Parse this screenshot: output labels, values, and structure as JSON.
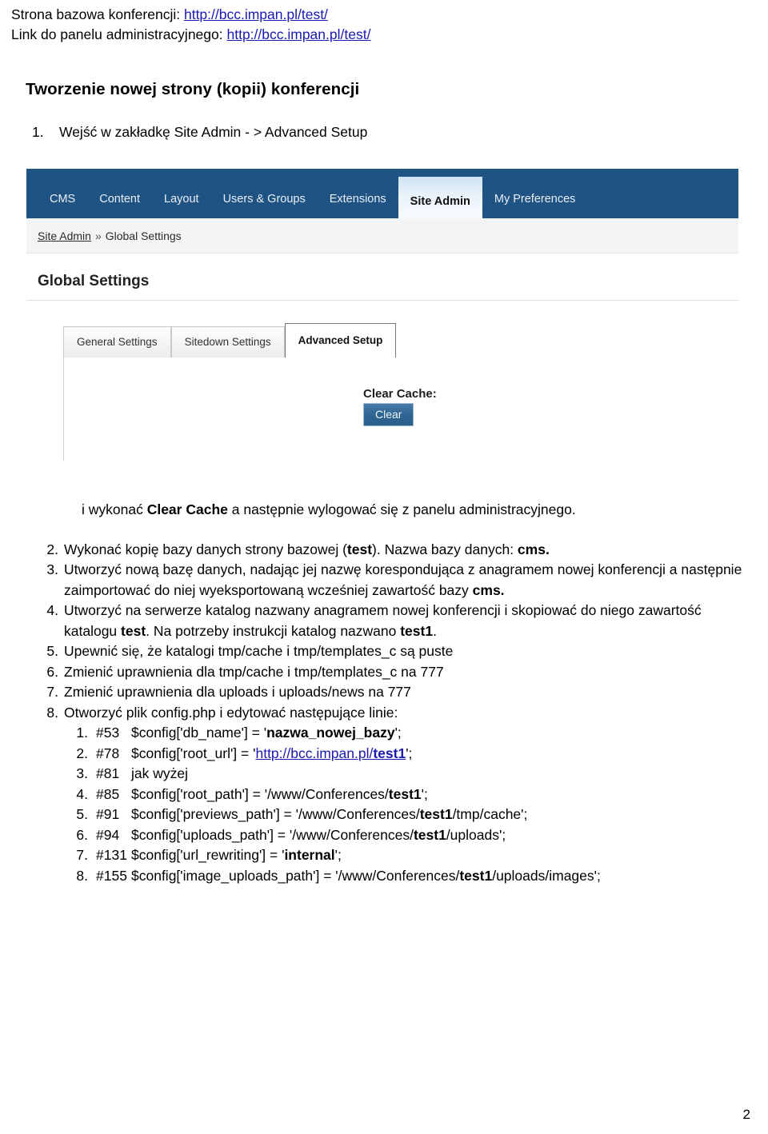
{
  "header": {
    "line1_label": "Strona bazowa konferencji: ",
    "line1_url": "http://bcc.impan.pl/test/",
    "line2_label": "Link do panelu administracyjnego: ",
    "line2_url": "http://bcc.impan.pl/test/"
  },
  "title": "Tworzenie nowej strony (kopii) konferencji",
  "step_one": {
    "number": "1.",
    "text": "Wejść w zakładkę Site Admin - > Advanced Setup"
  },
  "cms_screenshot": {
    "nav_tabs": [
      {
        "label": "CMS",
        "active": false
      },
      {
        "label": "Content",
        "active": false
      },
      {
        "label": "Layout",
        "active": false
      },
      {
        "label": "Users & Groups",
        "active": false
      },
      {
        "label": "Extensions",
        "active": false
      },
      {
        "label": "Site Admin",
        "active": true
      },
      {
        "label": "My Preferences",
        "active": false
      }
    ],
    "breadcrumb": {
      "root": "Site Admin",
      "separator": "»",
      "current": "Global Settings"
    },
    "page_heading": "Global Settings",
    "sub_tabs": [
      {
        "label": "General Settings",
        "active": false
      },
      {
        "label": "Sitedown Settings",
        "active": false
      },
      {
        "label": "Advanced Setup",
        "active": true
      }
    ],
    "clear_cache_label": "Clear Cache:",
    "clear_button_label": "Clear",
    "colors": {
      "navbar_blue": "#1f5384",
      "active_tab_gradient_top": "#cfe2f3",
      "clear_button_blue": "#2e6492"
    }
  },
  "after_screenshot_paragraph": {
    "part1": "i wykonać ",
    "bold": "Clear Cache",
    "part2": " a następnie wylogować się z panelu administracyjnego."
  },
  "steps": [
    {
      "n": 2,
      "segments": [
        {
          "t": "Wykonać kopię bazy danych strony bazowej (",
          "b": false
        },
        {
          "t": "test",
          "b": true
        },
        {
          "t": "). Nazwa bazy danych: ",
          "b": false
        },
        {
          "t": "cms.",
          "b": true
        }
      ]
    },
    {
      "n": 3,
      "segments": [
        {
          "t": "Utworzyć nową bazę danych, nadając jej nazwę korespondująca z anagramem nowej konferencji a następnie zaimportować do niej wyeksportowaną wcześniej zawartość bazy ",
          "b": false
        },
        {
          "t": "cms.",
          "b": true
        }
      ]
    },
    {
      "n": 4,
      "segments": [
        {
          "t": "Utworzyć na serwerze katalog nazwany anagramem nowej konferencji i skopiować do niego zawartość katalogu ",
          "b": false
        },
        {
          "t": "test",
          "b": true
        },
        {
          "t": ". Na potrzeby instrukcji katalog nazwano ",
          "b": false
        },
        {
          "t": "test1",
          "b": true
        },
        {
          "t": ".",
          "b": false
        }
      ]
    },
    {
      "n": 5,
      "segments": [
        {
          "t": "Upewnić się, że katalogi tmp/cache i tmp/templates_c są puste",
          "b": false
        }
      ]
    },
    {
      "n": 6,
      "segments": [
        {
          "t": "Zmienić uprawnienia dla tmp/cache i tmp/templates_c na 777",
          "b": false
        }
      ]
    },
    {
      "n": 7,
      "segments": [
        {
          "t": "Zmienić uprawnienia dla uploads  i uploads/news na 777",
          "b": false
        }
      ]
    },
    {
      "n": 8,
      "segments": [
        {
          "t": "Otworzyć plik config.php i edytować następujące linie:",
          "b": false
        }
      ]
    }
  ],
  "config_lines": [
    {
      "lineno": "#53",
      "segments": [
        {
          "t": "$config['db_name'] = '",
          "b": false
        },
        {
          "t": "nazwa_nowej_bazy",
          "b": true
        },
        {
          "t": "';",
          "b": false
        }
      ]
    },
    {
      "lineno": "#78",
      "segments": [
        {
          "t": "$config['root_url'] = '",
          "b": false
        },
        {
          "t": "http://bcc.impan.pl/",
          "b": false,
          "link": true
        },
        {
          "t": "test1",
          "b": true,
          "link": true
        },
        {
          "t": "';",
          "b": false
        }
      ]
    },
    {
      "lineno": "#81",
      "segments": [
        {
          "t": "jak wyżej",
          "b": false
        }
      ]
    },
    {
      "lineno": "#85",
      "segments": [
        {
          "t": "$config['root_path'] = '/www/Conferences/",
          "b": false
        },
        {
          "t": "test1",
          "b": true
        },
        {
          "t": "';",
          "b": false
        }
      ]
    },
    {
      "lineno": "#91",
      "segments": [
        {
          "t": "$config['previews_path'] = '/www/Conferences/",
          "b": false
        },
        {
          "t": "test1",
          "b": true
        },
        {
          "t": "/tmp/cache';",
          "b": false
        }
      ]
    },
    {
      "lineno": "#94",
      "segments": [
        {
          "t": "$config['uploads_path'] = '/www/Conferences/",
          "b": false
        },
        {
          "t": "test1",
          "b": true
        },
        {
          "t": "/uploads';",
          "b": false
        }
      ]
    },
    {
      "lineno": "#131",
      "segments": [
        {
          "t": "$config['url_rewriting'] = '",
          "b": false
        },
        {
          "t": "internal",
          "b": true
        },
        {
          "t": "';",
          "b": false
        }
      ]
    },
    {
      "lineno": "#155",
      "segments": [
        {
          "t": "$config['image_uploads_path'] = '/www/Conferences/",
          "b": false
        },
        {
          "t": "test1",
          "b": true
        },
        {
          "t": "/uploads/images';",
          "b": false
        }
      ]
    }
  ],
  "page_number": "2"
}
